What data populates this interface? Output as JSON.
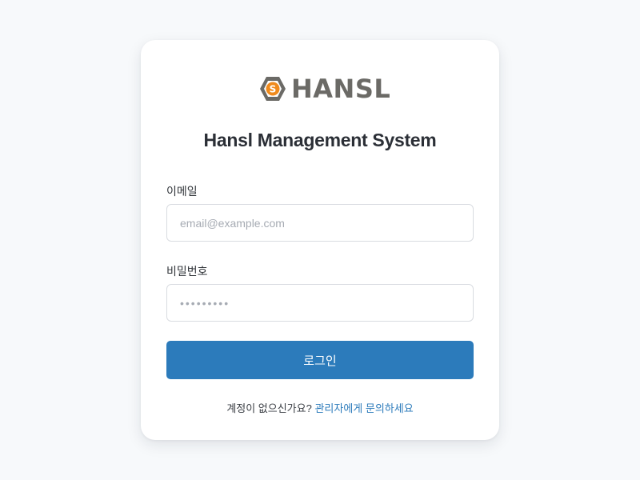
{
  "brand": {
    "logo_text": "HANSL",
    "logo_icon": "hexagon-s-coin-icon",
    "colors": {
      "logo_hex": "#6b6a66",
      "logo_coin": "#f08a1c"
    }
  },
  "login": {
    "title": "Hansl Management System",
    "email_label": "이메일",
    "email_placeholder": "email@example.com",
    "password_label": "비밀번호",
    "password_placeholder": "•••••••••",
    "submit_label": "로그인",
    "no_account_text": "계정이 없으신가요?",
    "contact_admin_link": "관리자에게 문의하세요"
  },
  "theme": {
    "primary": "#2c7bbb",
    "background": "#f7f9fb",
    "card": "#ffffff"
  }
}
